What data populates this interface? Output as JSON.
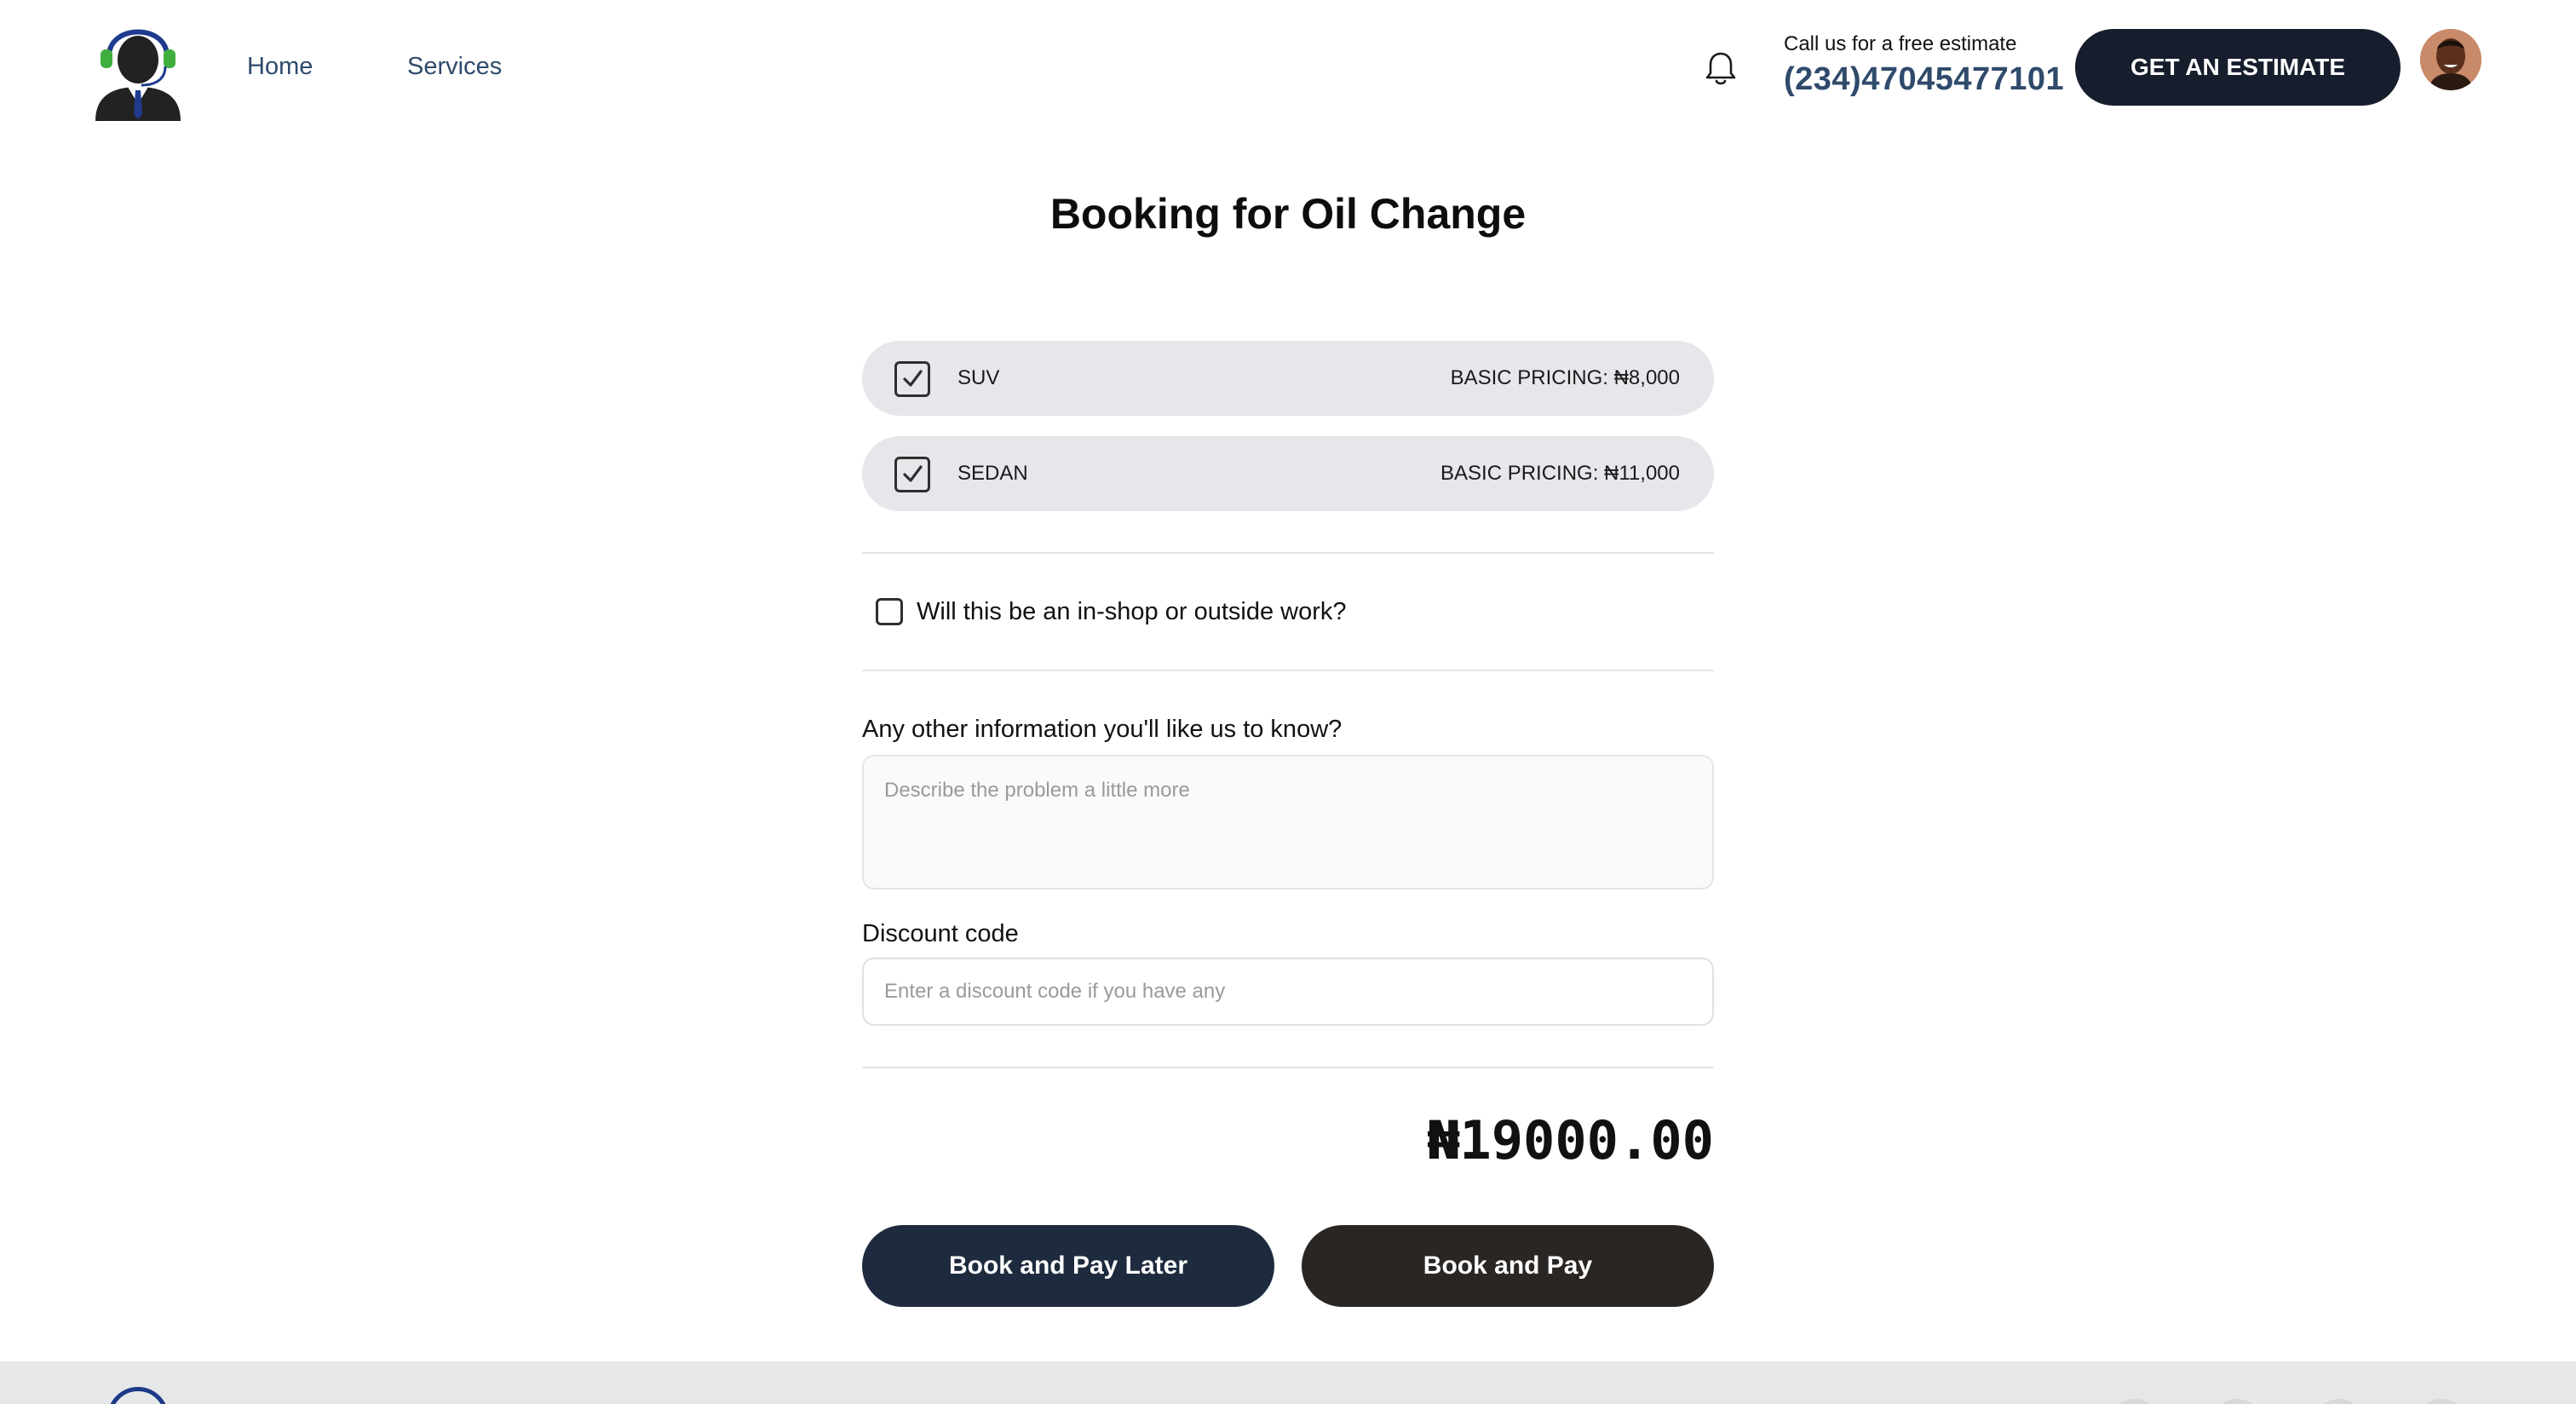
{
  "header": {
    "nav": {
      "home": "Home",
      "services": "Services"
    },
    "call_caption": "Call us for a free estimate",
    "phone": "(234)47045477101",
    "estimate_button": "GET AN ESTIMATE",
    "icons": {
      "logo": "support-agent-logo",
      "bell": "bell-icon",
      "avatar": "user-avatar"
    }
  },
  "main": {
    "title": "Booking for Oil Change",
    "vehicles": [
      {
        "name": "SUV",
        "price": "BASIC PRICING: ₦8,000",
        "checked": true
      },
      {
        "name": "SEDAN",
        "price": "BASIC PRICING: ₦11,000",
        "checked": true
      }
    ],
    "inshop": {
      "label": "Will this be an in-shop or outside work?",
      "checked": false
    },
    "info": {
      "label": "Any other information you'll like us to know?",
      "placeholder": "Describe the problem a little more"
    },
    "discount": {
      "label": "Discount code",
      "placeholder": "Enter a discount code if you have any"
    },
    "total": "₦19000.00",
    "buttons": {
      "later": "Book and Pay Later",
      "pay": "Book and Pay"
    }
  },
  "colors": {
    "primary_dark": "#161d2d",
    "link_blue": "#2f4a6b",
    "row_grey": "#e5e7eb",
    "pay_button": "#2a2623"
  }
}
